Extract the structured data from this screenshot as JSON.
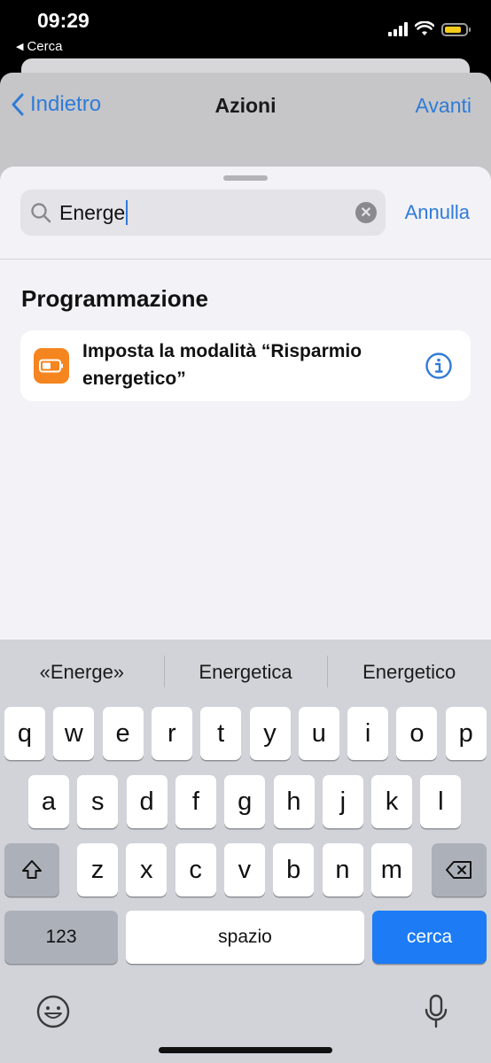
{
  "status_bar": {
    "time": "09:29",
    "back_label": "Cerca"
  },
  "nav": {
    "back_label": "Indietro",
    "title": "Azioni",
    "next_label": "Avanti"
  },
  "search": {
    "value": "Energe",
    "cancel_label": "Annulla"
  },
  "section": {
    "title": "Programmazione"
  },
  "action": {
    "label": "Imposta la modalità “Risparmio energetico”",
    "icon": "battery-icon",
    "accent_color": "#f5851f"
  },
  "keyboard": {
    "predictions": [
      "«Energe»",
      "Energetica",
      "Energetico"
    ],
    "row1": [
      "q",
      "w",
      "e",
      "r",
      "t",
      "y",
      "u",
      "i",
      "o",
      "p"
    ],
    "row2": [
      "a",
      "s",
      "d",
      "f",
      "g",
      "h",
      "j",
      "k",
      "l"
    ],
    "row3": [
      "z",
      "x",
      "c",
      "v",
      "b",
      "n",
      "m"
    ],
    "numbers_label": "123",
    "space_label": "spazio",
    "return_label": "cerca",
    "accent_color": "#1c7bf5"
  }
}
